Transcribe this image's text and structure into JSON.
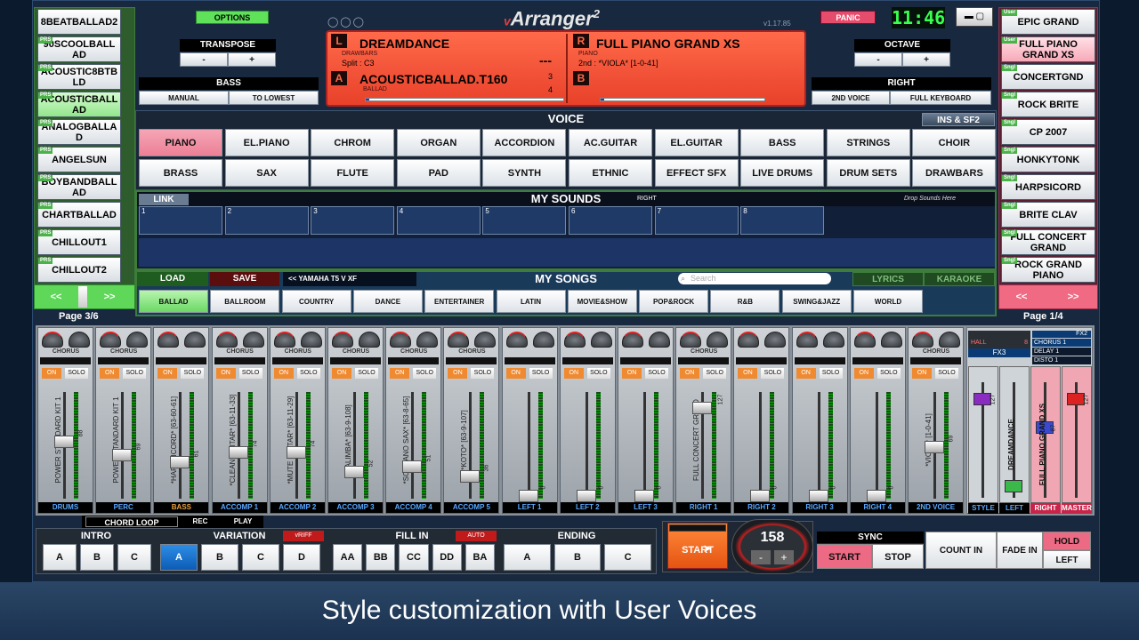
{
  "app": {
    "title": "Arranger",
    "title_sup": "2",
    "version": "v1.17.85",
    "clock": "11:46"
  },
  "buttons": {
    "options": "OPTIONS",
    "panic": "PANIC"
  },
  "transpose": {
    "label": "TRANSPOSE",
    "minus": "-",
    "plus": "+"
  },
  "octave": {
    "label": "OCTAVE",
    "minus": "-",
    "plus": "+"
  },
  "bass": {
    "label": "BASS",
    "manual": "MANUAL",
    "to_lowest": "TO LOWEST"
  },
  "right": {
    "label": "RIGHT",
    "second_voice": "2ND VOICE",
    "full_keyboard": "FULL KEYBOARD"
  },
  "display": {
    "l_letter": "L",
    "l_name": "DREAMDANCE",
    "l_sub": "DRAWBARS",
    "split": "Split : C3",
    "l_dash": "---",
    "a_letter": "A",
    "a_name": "ACOUSTICBALLAD.T160",
    "a_sub": "BALLAD",
    "a_n1": "3",
    "a_n2": "4",
    "r_letter": "R",
    "r_name": "FULL PIANO GRAND XS",
    "r_sub": "PIANO",
    "r_second": "2nd : *VIOLA* [1-0-41]",
    "b_letter": "B"
  },
  "left_styles": [
    {
      "tag": "",
      "label": "8BEATBALLAD2",
      "green": false
    },
    {
      "tag": "PRS",
      "label": "90SCOOLBALLAD",
      "green": false
    },
    {
      "tag": "PRS",
      "label": "ACOUSTIC8BTBLD",
      "green": false
    },
    {
      "tag": "PRS",
      "label": "ACOUSTICBALLAD",
      "green": true
    },
    {
      "tag": "PRS",
      "label": "ANALOGBALLAD",
      "green": false
    },
    {
      "tag": "PRS",
      "label": "ANGELSUN",
      "green": false
    },
    {
      "tag": "PRS",
      "label": "BOYBANDBALLAD",
      "green": false
    },
    {
      "tag": "PRS",
      "label": "CHARTBALLAD",
      "green": false
    },
    {
      "tag": "PRS",
      "label": "CHILLOUT1",
      "green": false
    },
    {
      "tag": "PRS",
      "label": "CHILLOUT2",
      "green": false
    }
  ],
  "left_nav": {
    "prev": "<<",
    "next": ">>",
    "page": "Page 3/6"
  },
  "right_voices": [
    {
      "tag": "User",
      "label": "EPIC GRAND"
    },
    {
      "tag": "User",
      "label": "FULL PIANO GRAND XS"
    },
    {
      "tag": "Sngl",
      "label": "CONCERTGND"
    },
    {
      "tag": "Sngl",
      "label": "ROCK BRITE"
    },
    {
      "tag": "Sngl",
      "label": "CP 2007"
    },
    {
      "tag": "Sngl",
      "label": "HONKYTONK"
    },
    {
      "tag": "Sngl",
      "label": "HARPSICORD"
    },
    {
      "tag": "Sngl",
      "label": "BRITE CLAV"
    },
    {
      "tag": "Sngl",
      "label": "FULL CONCERT GRAND"
    },
    {
      "tag": "Sngl",
      "label": "ROCK GRAND PIANO"
    }
  ],
  "right_nav": {
    "prev": "<<",
    "next": ">>",
    "page": "Page 1/4"
  },
  "voice": {
    "header": "VOICE",
    "ins_sf2": "INS & SF2",
    "row1": [
      "PIANO",
      "EL.PIANO",
      "CHROM",
      "ORGAN",
      "ACCORDION",
      "AC.GUITAR",
      "EL.GUITAR",
      "BASS",
      "STRINGS",
      "CHOIR"
    ],
    "row2": [
      "BRASS",
      "SAX",
      "FLUTE",
      "PAD",
      "SYNTH",
      "ETHNIC",
      "EFFECT SFX",
      "LIVE DRUMS",
      "DRUM SETS",
      "DRAWBARS"
    ]
  },
  "my_sounds": {
    "link": "LINK",
    "title": "MY SOUNDS",
    "right": "RIGHT",
    "drop": "Drop Sounds Here",
    "slots": [
      "1",
      "2",
      "3",
      "4",
      "5",
      "6",
      "7",
      "8"
    ]
  },
  "my_songs": {
    "load": "LOAD",
    "save": "SAVE",
    "folder": "<< YAMAHA T5 V XF",
    "title": "MY SONGS",
    "search": "Search",
    "lyrics": "LYRICS",
    "karaoke": "KARAOKE",
    "genres": [
      "BALLAD",
      "BALLROOM",
      "COUNTRY",
      "DANCE",
      "ENTERTAINER",
      "LATIN",
      "MOVIE&SHOW",
      "POP&ROCK",
      "R&B",
      "SWING&JAZZ",
      "WORLD"
    ]
  },
  "mixer": {
    "on": "ON",
    "solo": "SOLO",
    "chorus": "CHORUS",
    "channels": [
      {
        "name": "DRUMS",
        "voice": "POWER STANDARD KIT 1",
        "val": "88",
        "level": 0.55,
        "fx": "CHORUS"
      },
      {
        "name": "PERC",
        "voice": "POWER STANDARD KIT 1",
        "val": "69",
        "level": 0.42,
        "fx": "CHORUS"
      },
      {
        "name": "BASS",
        "voice": "*HARPSICORD* [63-60-61]",
        "val": "61",
        "level": 0.35,
        "fx": ""
      },
      {
        "name": "ACCOMP 1",
        "voice": "*CLEAN GUITAR* [63-11-33]",
        "val": "74",
        "level": 0.45,
        "fx": "CHORUS"
      },
      {
        "name": "ACCOMP 2",
        "voice": "*MUTE GUITAR* [63-11-29]",
        "val": "74",
        "level": 0.45,
        "fx": "CHORUS"
      },
      {
        "name": "ACCOMP 3",
        "voice": "*KALIMBA* [63-9-108]",
        "val": "52",
        "level": 0.25,
        "fx": "CHORUS"
      },
      {
        "name": "ACCOMP 4",
        "voice": "*SOPRANO SAX* [63-8-65]",
        "val": "51",
        "level": 0.3,
        "fx": "CHORUS"
      },
      {
        "name": "ACCOMP 5",
        "voice": "*KOTO* [63-9-107]",
        "val": "36",
        "level": 0.2,
        "fx": "CHORUS"
      },
      {
        "name": "LEFT 1",
        "voice": "",
        "val": "0",
        "level": 0.0,
        "fx": ""
      },
      {
        "name": "LEFT 2",
        "voice": "",
        "val": "0",
        "level": 0.0,
        "fx": ""
      },
      {
        "name": "LEFT 3",
        "voice": "",
        "val": "0",
        "level": 0.0,
        "fx": ""
      },
      {
        "name": "RIGHT 1",
        "voice": "FULL CONCERT GRAND",
        "val": "127",
        "level": 0.9,
        "fx": "CHORUS"
      },
      {
        "name": "RIGHT 2",
        "voice": "",
        "val": "0",
        "level": 0.0,
        "fx": ""
      },
      {
        "name": "RIGHT 3",
        "voice": "",
        "val": "0",
        "level": 0.0,
        "fx": ""
      },
      {
        "name": "RIGHT 4",
        "voice": "",
        "val": "0",
        "level": 0.0,
        "fx": ""
      },
      {
        "name": "2ND VOICE",
        "voice": "*VIOLA* [1-0-41]",
        "val": "69",
        "level": 0.5,
        "fx": "CHORUS"
      }
    ],
    "fx_panel": {
      "hall": "HALL",
      "fx1_value": "8",
      "fx3": "FX3",
      "fx2": "FX2",
      "chorus1": "CHORUS 1",
      "delay1": "DELAY 1",
      "disto1": "DISTO 1",
      "zero": "0"
    },
    "strips": [
      {
        "name": "STYLE",
        "voice": "",
        "val": "127"
      },
      {
        "name": "LEFT",
        "voice": "DREAMDANCE",
        "val": ""
      },
      {
        "name": "RIGHT",
        "voice": "FULL PIANO GRAND XS",
        "val": "87"
      },
      {
        "name": "MASTER",
        "voice": "",
        "val": "127"
      }
    ]
  },
  "transport": {
    "chord_loop": "CHORD LOOP",
    "rec": "REC",
    "play": "PLAY",
    "intro": "INTRO",
    "variation": "VARIATION",
    "vriff": "vRIFF",
    "fill_in": "FILL IN",
    "auto": "AUTO",
    "ending": "ENDING",
    "intro_btns": [
      "A",
      "B",
      "C"
    ],
    "var_btns": [
      "A",
      "B",
      "C",
      "D"
    ],
    "fill_btns": [
      "AA",
      "BB",
      "CC",
      "DD",
      "BA"
    ],
    "end_btns": [
      "A",
      "B",
      "C"
    ],
    "start": "START",
    "tempo": "158",
    "tempo_minus": "-",
    "tempo_plus": "+",
    "sync": "SYNC",
    "sync_start": "START",
    "sync_stop": "STOP",
    "count_in": "COUNT IN",
    "fade_in": "FADE IN",
    "hold": "HOLD",
    "left": "LEFT"
  },
  "caption": "Style customization with User Voices"
}
